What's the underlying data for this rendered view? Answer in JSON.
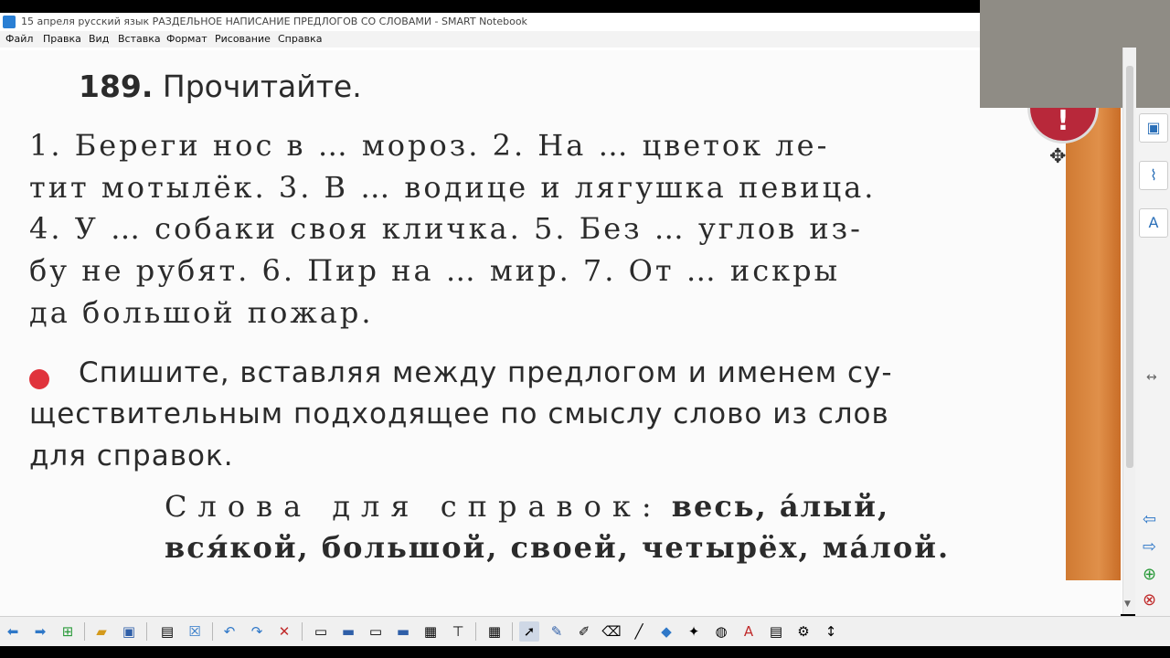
{
  "window": {
    "title": "15 апреля русский язык РАЗДЕЛЬНОЕ НАПИСАНИЕ ПРЕДЛОГОВ СО СЛОВАМИ - SMART Notebook"
  },
  "menu": [
    "Файл",
    "Правка",
    "Вид",
    "Вставка",
    "Формат",
    "Рисование",
    "Справка"
  ],
  "exercise": {
    "number": "189.",
    "heading": "Прочитайте.",
    "lines": [
      "1. Береги нос в … мороз. 2. На … цветок ле-",
      "тит мотылёк. 3. В … водице и лягушка певица.",
      "4. У … собаки своя кличка. 5. Без … углов из-",
      "бу не рубят. 6. Пир на … мир. 7. От … искры",
      "да большой пожар."
    ],
    "task_lines": [
      "Спишите, вставляя между предлогом и именем су-",
      "ществительным подходящее по смыслу слово из слов",
      "для справок."
    ],
    "reference_label": "Слова для справок:",
    "reference_line1": "весь, а́лый,",
    "reference_line2": "вся́кой, большой, своей, четырёх, ма́лой."
  },
  "badge_text": "!",
  "icons": {
    "back": "arrow-left-icon",
    "forward": "arrow-right-icon",
    "move": "move-icon"
  },
  "colors": {
    "bullet": "#e0333c",
    "strip": "#d07a32",
    "badge": "#b8283a"
  }
}
